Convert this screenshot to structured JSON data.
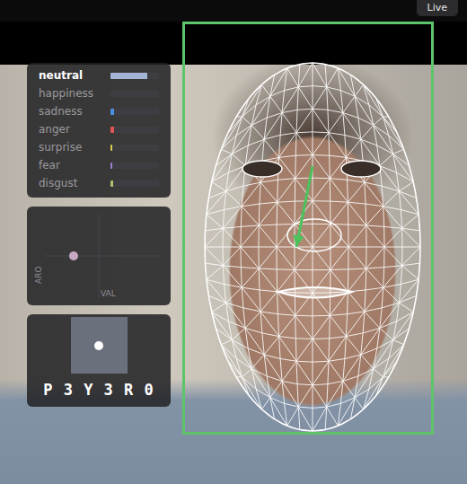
{
  "top_bar": {
    "live_button": "Live"
  },
  "emotions": [
    {
      "label": "neutral",
      "selected": true,
      "level": 0.75,
      "color": "#a3b4d6"
    },
    {
      "label": "happiness",
      "selected": false,
      "level": 0.0,
      "color": "#7fc97f"
    },
    {
      "label": "sadness",
      "selected": false,
      "level": 0.08,
      "color": "#4a90e2"
    },
    {
      "label": "anger",
      "selected": false,
      "level": 0.08,
      "color": "#e05555"
    },
    {
      "label": "surprise",
      "selected": false,
      "level": 0.04,
      "color": "#d6c84a"
    },
    {
      "label": "fear",
      "selected": false,
      "level": 0.03,
      "color": "#9b7fd1"
    },
    {
      "label": "disgust",
      "selected": false,
      "level": 0.05,
      "color": "#a8c46a"
    }
  ],
  "valence_arousal": {
    "x_label": "VAL",
    "y_label": "ARO",
    "points": [
      {
        "valence": -0.4,
        "arousal": 0.0
      }
    ]
  },
  "head_pose": {
    "yaw": 0.0,
    "pitch": 0.0
  },
  "code": "P 3 Y 3 R 0",
  "face": {
    "detected": true,
    "gaze": {
      "dx": -0.2,
      "dy": 1.0
    }
  }
}
